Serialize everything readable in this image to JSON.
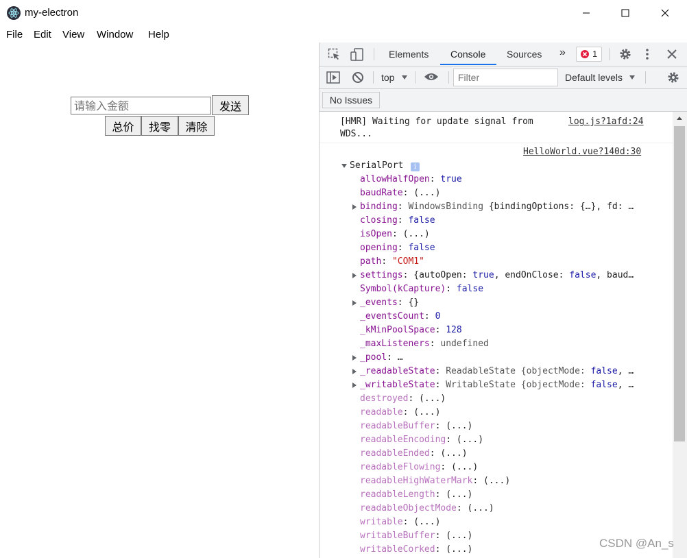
{
  "window": {
    "title": "my-electron"
  },
  "menu": [
    "File",
    "Edit",
    "View",
    "Window",
    "Help"
  ],
  "app": {
    "amount_placeholder": "请输入金额",
    "send_label": "发送",
    "total_label": "总价",
    "change_label": "找零",
    "clear_label": "清除"
  },
  "devtools": {
    "tabs": [
      "Elements",
      "Console",
      "Sources"
    ],
    "error_count": "1",
    "context": "top",
    "filter_placeholder": "Filter",
    "levels": "Default levels",
    "issues": "No Issues",
    "log1_text": "[HMR] Waiting for update signal from",
    "log1_text2": "WDS...",
    "log1_source": "log.js?1afd:24",
    "log2_source": "HelloWorld.vue?140d:30",
    "object_name": "SerialPort",
    "props": [
      {
        "key": "allowHalfOpen",
        "val": "true"
      },
      {
        "key": "baudRate",
        "val": "(...)"
      },
      {
        "key": "binding",
        "val": "WindowsBinding {bindingOptions: {…}, fd: …"
      },
      {
        "key": "closing",
        "val": "false"
      },
      {
        "key": "isOpen",
        "val": "(...)"
      },
      {
        "key": "opening",
        "val": "false"
      },
      {
        "key": "path",
        "val": "\"COM1\""
      },
      {
        "key": "settings",
        "val": "{autoOpen: true, endOnClose: false, baud…"
      },
      {
        "key": "Symbol(kCapture)",
        "val": "false"
      },
      {
        "key": "_events",
        "val": "{}"
      },
      {
        "key": "_eventsCount",
        "val": "0"
      },
      {
        "key": "_kMinPoolSpace",
        "val": "128"
      },
      {
        "key": "_maxListeners",
        "val": "undefined"
      },
      {
        "key": "_pool",
        "val": "…"
      },
      {
        "key": "_readableState",
        "val": "ReadableState {objectMode: false, …"
      },
      {
        "key": "_writableState",
        "val": "WritableState {objectMode: false, …"
      },
      {
        "key": "destroyed",
        "val": "(...)"
      },
      {
        "key": "readable",
        "val": "(...)"
      },
      {
        "key": "readableBuffer",
        "val": "(...)"
      },
      {
        "key": "readableEncoding",
        "val": "(...)"
      },
      {
        "key": "readableEnded",
        "val": "(...)"
      },
      {
        "key": "readableFlowing",
        "val": "(...)"
      },
      {
        "key": "readableHighWaterMark",
        "val": "(...)"
      },
      {
        "key": "readableLength",
        "val": "(...)"
      },
      {
        "key": "readableObjectMode",
        "val": "(...)"
      },
      {
        "key": "writable",
        "val": "(...)"
      },
      {
        "key": "writableBuffer",
        "val": "(...)"
      },
      {
        "key": "writableCorked",
        "val": "(...)"
      }
    ]
  },
  "watermark": "CSDN @An_s"
}
